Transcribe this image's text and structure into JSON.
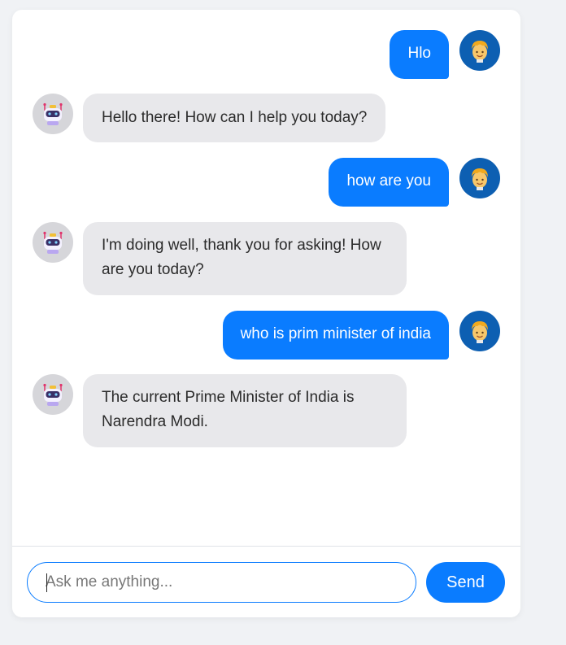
{
  "messages": [
    {
      "role": "user",
      "text": "Hlo"
    },
    {
      "role": "bot",
      "text": "Hello there! How can I help you today?"
    },
    {
      "role": "user",
      "text": "how are you"
    },
    {
      "role": "bot",
      "text": "I'm doing well, thank you for asking! How are you today?"
    },
    {
      "role": "user",
      "text": "who is prim minister of india"
    },
    {
      "role": "bot",
      "text": "The current Prime Minister of India is Narendra Modi."
    }
  ],
  "avatars": {
    "user_icon": "smiling-person-icon",
    "bot_icon": "robot-icon"
  },
  "composer": {
    "placeholder": "Ask me anything...",
    "value": "",
    "send_label": "Send"
  },
  "colors": {
    "accent": "#0a7cff",
    "user_avatar_bg": "#0d5fb2",
    "bot_bubble_bg": "#e8e8eb",
    "bot_avatar_bg": "#d6d6da",
    "page_bg": "#f0f2f5"
  }
}
